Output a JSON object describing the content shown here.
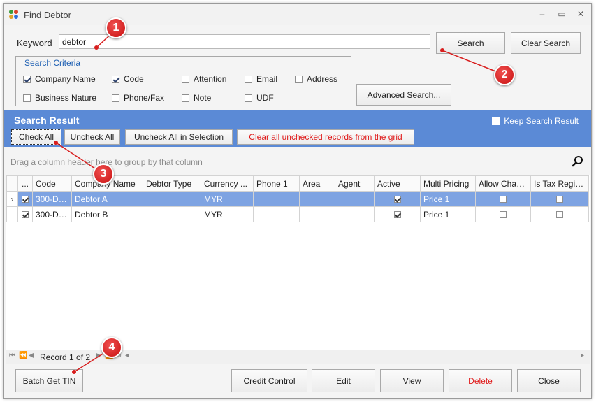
{
  "window": {
    "title": "Find Debtor",
    "controls": [
      "–",
      "▭",
      "✕"
    ]
  },
  "keyword": {
    "label": "Keyword",
    "value": "debtor"
  },
  "buttons": {
    "search": "Search",
    "clear_search": "Clear Search",
    "advanced_search": "Advanced Search...",
    "check_all": "Check All",
    "uncheck_all": "Uncheck All",
    "uncheck_all_selection": "Uncheck All in Selection",
    "clear_unchecked": "Clear all unchecked records from the grid"
  },
  "criteria": {
    "title": "Search Criteria",
    "items": [
      {
        "label": "Company Name",
        "checked": true
      },
      {
        "label": "Code",
        "checked": true
      },
      {
        "label": "Attention",
        "checked": false
      },
      {
        "label": "Email",
        "checked": false
      },
      {
        "label": "Address",
        "checked": false
      },
      {
        "label": "Business Nature",
        "checked": false
      },
      {
        "label": "Phone/Fax",
        "checked": false
      },
      {
        "label": "Note",
        "checked": false
      },
      {
        "label": "UDF",
        "checked": false
      }
    ]
  },
  "result": {
    "title": "Search Result",
    "keep_label": "Keep Search Result",
    "group_hint": "Drag a column header here to group by that column"
  },
  "grid": {
    "columns": [
      "...",
      "Code",
      "Company Name",
      "Debtor Type",
      "Currency ...",
      "Phone 1",
      "Area",
      "Agent",
      "Active",
      "Multi Pricing",
      "Allow Chan...",
      "Is Tax Regis..."
    ],
    "rows": [
      {
        "checked": true,
        "code": "300-D0...",
        "company": "Debtor A",
        "debtor_type": "",
        "currency": "MYR",
        "phone": "",
        "area": "",
        "agent": "",
        "active": true,
        "pricing": "Price 1",
        "allow_change": false,
        "tax_reg": false
      },
      {
        "checked": true,
        "code": "300-D0...",
        "company": "Debtor B",
        "debtor_type": "",
        "currency": "MYR",
        "phone": "",
        "area": "",
        "agent": "",
        "active": true,
        "pricing": "Price 1",
        "allow_change": false,
        "tax_reg": false
      }
    ]
  },
  "navigator": {
    "record_text": "Record 1 of 2"
  },
  "footer": {
    "batch_tin": "Batch Get TIN",
    "credit_control": "Credit Control",
    "edit": "Edit",
    "view": "View",
    "delete": "Delete",
    "close": "Close"
  },
  "markers": [
    "1",
    "2",
    "3",
    "4"
  ],
  "colors": {
    "accent": "#5b8ad6",
    "selected_row": "#7ea3e2",
    "delete_text": "#e01a1a",
    "marker": "#d81e1e"
  }
}
